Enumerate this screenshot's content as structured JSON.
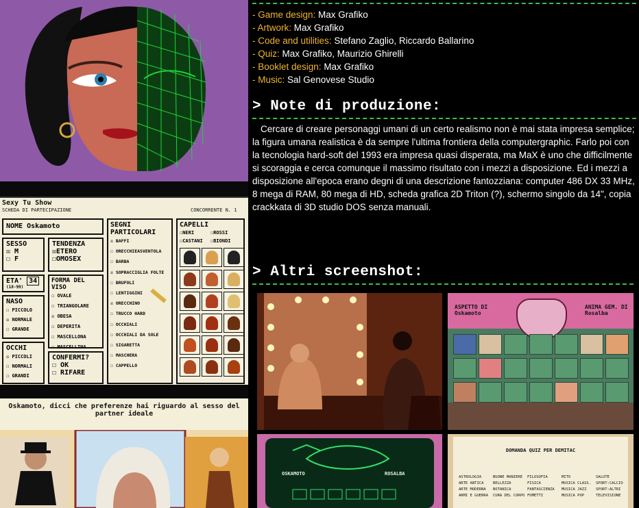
{
  "credits": [
    {
      "key": "- Game design:",
      "value": " Max Grafiko"
    },
    {
      "key": "- Artwork:",
      "value": " Max Grafiko"
    },
    {
      "key": "- Code and utilities:",
      "value": " Stefano Zaglio, Riccardo Ballarino"
    },
    {
      "key": "- Quiz:",
      "value": " Max Grafiko, Maurizio Ghirelli"
    },
    {
      "key": "- Booklet design:",
      "value": " Max Grafiko"
    },
    {
      "key": "- Music:",
      "value": " Sal Genovese Studio"
    }
  ],
  "notes": {
    "heading": "> Note di produzione:",
    "text": "Cercare di creare personaggi umani di un certo realismo non è mai stata impresa semplice; la figura umana realistica è da sempre l'ultima frontiera della computergraphic. Farlo poi con la tecnologia hard-soft del 1993 era impresa quasi disperata, ma MaX è uno che difficilmente si scoraggia e cerca comunque il massimo risultato con i mezzi a disposizione. Ed i mezzi a disposizione all'epoca erano degni di una descrizione fantozziana: computer 486 DX 33 MHz, 8 mega di RAM, 80 mega di HD, scheda grafica 2D Triton (?), schermo singolo da 14\", copia crackkata di 3D studio DOS senza manuali."
  },
  "screens": {
    "heading": "> Altri screenshot:"
  },
  "form": {
    "title": "Sexy Tu Show",
    "subtitle": "SCHEDA DI PARTECIPAZIONE",
    "contestant": "CONCORRENTE N. 1",
    "name_label": "NOME Oskamoto",
    "sesso": "SESSO",
    "m": "M",
    "f": "F",
    "tendenza": "TENDENZA",
    "etero": "ETERO",
    "omosex": "OMOSEX",
    "eta": "ETA'",
    "age_range": "(18-99)",
    "age": "34",
    "forma": "FORMA DEL VISO",
    "face_opts": [
      "OVALE",
      "TRIANGOLARE",
      "OBESA",
      "DEPERITA",
      "MASCELLONA",
      "MASCELLINA"
    ],
    "naso": "NASO",
    "nose_opts": [
      "PICCOLO",
      "NORMALE",
      "GRANDE"
    ],
    "occhi": "OCCHI",
    "eye_opts": [
      "PICCOLI",
      "NORMALI",
      "GRANDI"
    ],
    "confermi": "CONFERMI?",
    "ok": "OK",
    "rifare": "RIFARE",
    "segni": "SEGNI PARTICOLARI",
    "segni_opts": [
      "BAFFI",
      "ORECCHIEASVENTOLA",
      "BARBA",
      "SOPRACCIGLIA FOLTE",
      "BRUFOLI",
      "LENTIGGINI",
      "ORECCHINO",
      "TRUCCO HARD",
      "OCCHIALI",
      "OCCHIALI DA SOLE",
      "SIGARETTA",
      "MASCHERA",
      "CAPPELLO"
    ],
    "capelli": "CAPELLI",
    "hair_opts": [
      "NERI",
      "ROSSI",
      "CASTANI",
      "BIONDI"
    ]
  },
  "quiz": {
    "question": "Oskamoto, dicci che preferenze hai riguardo al sesso del partner ideale"
  },
  "thumb2": {
    "left": "ASPETTO DI Oskamoto",
    "right": "ANIMA GEM. DI Rosalba"
  },
  "thumb3": {
    "left": "OSKAMOTO",
    "right": "ROSALBA"
  },
  "thumb4": {
    "title": "DOMANDA QUIZ PER DEMITAC",
    "categories": [
      "ASTROLOGIA",
      "BUONE MANIERE",
      "FILOSOFIA",
      "MITO",
      "SALUTE",
      "ARTE ANTICA",
      "BELLEZZA",
      "FISICA",
      "MUSICA CLASS.",
      "SPORT:CALCIO",
      "ARTE MODERNA",
      "BOTANICA",
      "FANTASCIENZA",
      "MUSICA JAZZ",
      "SPORT:ALTRI",
      "ARMI E GUERRA",
      "CURA DEL CORPO",
      "FUMETTI",
      "MUSICA POP",
      "TELEVISIONE"
    ]
  }
}
